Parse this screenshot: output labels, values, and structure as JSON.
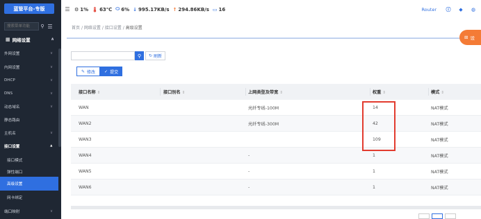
{
  "sidebar": {
    "brand": "蓝管平台-专版",
    "search_placeholder": "搜索菜单功能",
    "section_title": "网络设置",
    "items": [
      {
        "label": "外网设置",
        "chev": "∨"
      },
      {
        "label": "内网设置",
        "chev": "∨"
      },
      {
        "label": "DHCP",
        "chev": "∨"
      },
      {
        "label": "DNS",
        "chev": "∨"
      },
      {
        "label": "动态域名",
        "chev": "∨"
      },
      {
        "label": "静态路由",
        "chev": ""
      },
      {
        "label": "主机名",
        "chev": "∨"
      },
      {
        "label": "接口设置",
        "chev": "∧"
      },
      {
        "label": "接口模式",
        "chev": ""
      },
      {
        "label": "弹性端口",
        "chev": ""
      },
      {
        "label": "高级设置",
        "chev": ""
      },
      {
        "label": "网卡绑定",
        "chev": ""
      },
      {
        "label": "端口映射",
        "chev": "∨"
      }
    ]
  },
  "topbar": {
    "cpu": "1%",
    "temp": "63℃",
    "mem": "6%",
    "down": "995.17KB/s",
    "up": "294.86KB/s",
    "terminals": "16",
    "router_label": "Router"
  },
  "breadcrumb": {
    "home": "首页",
    "sep": "/",
    "level1": "网络设置",
    "level2": "接口设置",
    "current": "高级设置"
  },
  "fab_label": "设",
  "toolbar": {
    "search_placeholder": "",
    "refresh_label": "刷新",
    "edit_label": "修改",
    "submit_label": "提交"
  },
  "table": {
    "headers": [
      "接口名称",
      "接口别名",
      "上网类型及带宽",
      "权重",
      "模式"
    ],
    "sort_glyph": "⇕",
    "rows": [
      {
        "name": "WAN",
        "alias": "",
        "type": "光纤专线-100M",
        "weight": "14",
        "mode": "NAT模式"
      },
      {
        "name": "WAN2",
        "alias": "",
        "type": "光纤专线-300M",
        "weight": "42",
        "mode": "NAT模式"
      },
      {
        "name": "WAN3",
        "alias": "",
        "type": "",
        "weight": "109",
        "mode": "NAT模式"
      },
      {
        "name": "WAN4",
        "alias": "",
        "type": "-",
        "weight": "1",
        "mode": "NAT模式"
      },
      {
        "name": "WAN5",
        "alias": "",
        "type": "-",
        "weight": "1",
        "mode": "NAT模式"
      },
      {
        "name": "WAN6",
        "alias": "",
        "type": "-",
        "weight": "1",
        "mode": "NAT模式"
      }
    ]
  },
  "colors": {
    "accent": "#2f6fe0",
    "sidebar_bg": "#1f2733",
    "highlight": "#e23b2e",
    "fab": "#f47b36"
  }
}
